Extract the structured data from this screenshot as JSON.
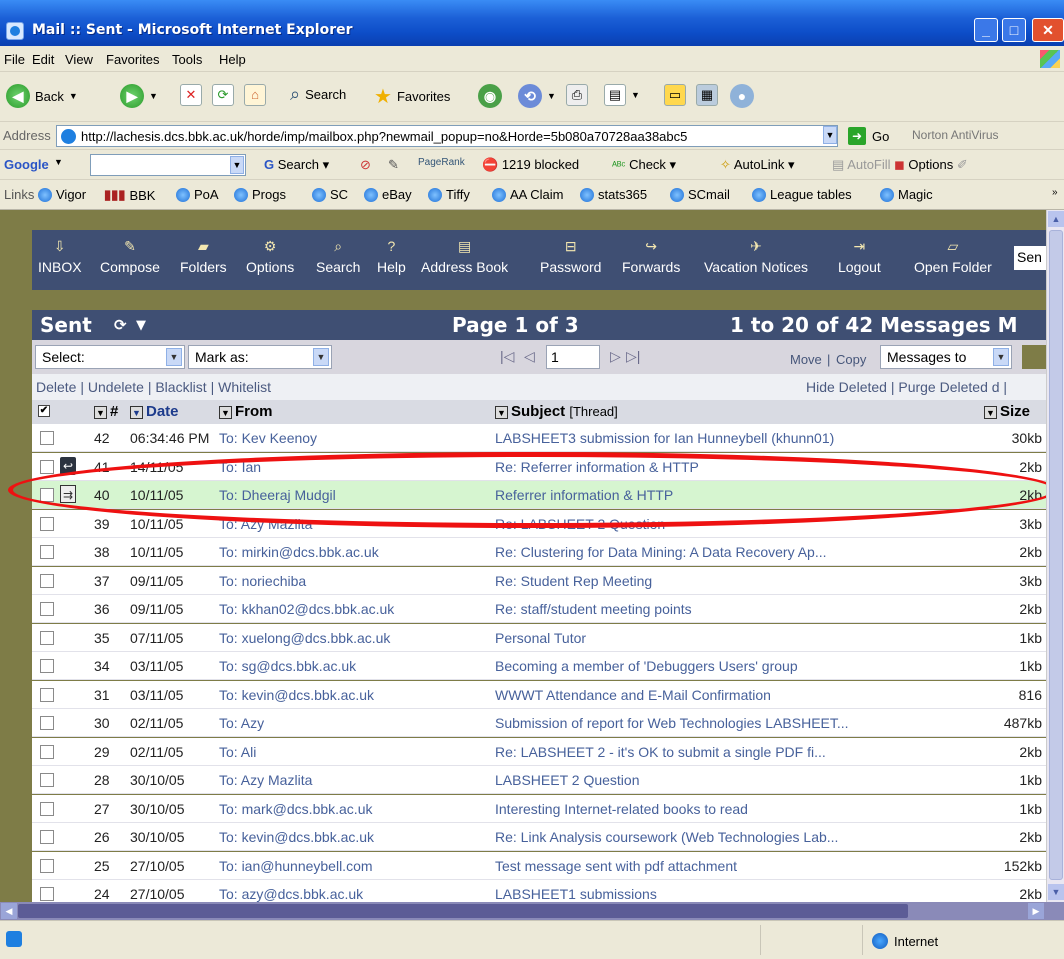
{
  "window": {
    "title": "Mail :: Sent - Microsoft Internet Explorer"
  },
  "menu": [
    "File",
    "Edit",
    "View",
    "Favorites",
    "Tools",
    "Help"
  ],
  "toolbar": {
    "back": "Back",
    "search": "Search",
    "favorites": "Favorites"
  },
  "address": {
    "label": "Address",
    "url": "http://lachesis.dcs.bbk.ac.uk/horde/imp/mailbox.php?newmail_popup=no&Horde=5b080a70728aa38abc5",
    "go": "Go",
    "norton": "Norton AntiVirus"
  },
  "google_bar": {
    "logo": "Google",
    "search": "Search",
    "pagerank": "PageRank",
    "blocked": "1219 blocked",
    "check": "Check",
    "autolink": "AutoLink",
    "autofill": "AutoFill",
    "options": "Options"
  },
  "links_bar": {
    "label": "Links",
    "items": [
      "Vigor",
      "BBK",
      "PoA",
      "Progs",
      "SC",
      "eBay",
      "Tiffy",
      "AA Claim",
      "stats365",
      "SCmail",
      "League tables",
      "Magic"
    ]
  },
  "app_nav": {
    "items": [
      "INBOX",
      "Compose",
      "Folders",
      "Options",
      "Search",
      "Help",
      "Address Book",
      "Password",
      "Forwards",
      "Vacation Notices",
      "Logout",
      "Open Folder"
    ],
    "search_text": "Sen"
  },
  "mailbox": {
    "name": "Sent",
    "page": "Page 1 of 3",
    "count": "1 to 20 of 42 Messages M",
    "select_label": "Select:",
    "mark_as_label": "Mark as:",
    "page_input": "1",
    "move": "Move",
    "copy": "Copy",
    "messages_to": "Messages to",
    "actions_left": "Delete | Undelete | Blacklist | Whitelist",
    "actions_right": "Hide Deleted | Purge Deleted d |"
  },
  "columns": {
    "number": "#",
    "date": "Date",
    "from": "From",
    "subject": "Subject",
    "thread": "[Thread]",
    "size": "Size"
  },
  "messages": [
    {
      "num": "42",
      "date": "06:34:46 PM",
      "from": "To: Kev Keenoy",
      "subject": "LABSHEET3 submission for Ian Hunneybell (khunn01)",
      "size": "30kb",
      "flag": ""
    },
    {
      "num": "41",
      "date": "14/11/05",
      "from": "To: Ian",
      "subject": "Re: Referrer information & HTTP",
      "size": "2kb",
      "flag": "reply"
    },
    {
      "num": "40",
      "date": "10/11/05",
      "from": "To: Dheeraj Mudgil",
      "subject": "Referrer information & HTTP",
      "size": "2kb",
      "flag": "fwd"
    },
    {
      "num": "39",
      "date": "10/11/05",
      "from": "To: Azy Mazlita",
      "subject": "Re: LABSHEET 2 Question",
      "size": "3kb",
      "flag": ""
    },
    {
      "num": "38",
      "date": "10/11/05",
      "from": "To: mirkin@dcs.bbk.ac.uk",
      "subject": "Re: Clustering for Data Mining: A Data Recovery Ap...",
      "size": "2kb",
      "flag": ""
    },
    {
      "num": "37",
      "date": "09/11/05",
      "from": "To: noriechiba",
      "subject": "Re: Student Rep Meeting",
      "size": "3kb",
      "flag": ""
    },
    {
      "num": "36",
      "date": "09/11/05",
      "from": "To: kkhan02@dcs.bbk.ac.uk",
      "subject": "Re: staff/student meeting points",
      "size": "2kb",
      "flag": ""
    },
    {
      "num": "35",
      "date": "07/11/05",
      "from": "To: xuelong@dcs.bbk.ac.uk",
      "subject": "Personal Tutor",
      "size": "1kb",
      "flag": ""
    },
    {
      "num": "34",
      "date": "03/11/05",
      "from": "To: sg@dcs.bbk.ac.uk",
      "subject": "Becoming a member of 'Debuggers Users' group",
      "size": "1kb",
      "flag": ""
    },
    {
      "num": "31",
      "date": "03/11/05",
      "from": "To: kevin@dcs.bbk.ac.uk",
      "subject": "WWWT Attendance and E-Mail Confirmation",
      "size": "816",
      "flag": ""
    },
    {
      "num": "30",
      "date": "02/11/05",
      "from": "To: Azy",
      "subject": "Submission of report for Web Technologies LABSHEET...",
      "size": "487kb",
      "flag": ""
    },
    {
      "num": "29",
      "date": "02/11/05",
      "from": "To: Ali",
      "subject": "Re: LABSHEET 2 - it's OK to submit a single PDF fi...",
      "size": "2kb",
      "flag": ""
    },
    {
      "num": "28",
      "date": "30/10/05",
      "from": "To: Azy Mazlita",
      "subject": "LABSHEET 2 Question",
      "size": "1kb",
      "flag": ""
    },
    {
      "num": "27",
      "date": "30/10/05",
      "from": "To: mark@dcs.bbk.ac.uk",
      "subject": "Interesting Internet-related books to read",
      "size": "1kb",
      "flag": ""
    },
    {
      "num": "26",
      "date": "30/10/05",
      "from": "To: kevin@dcs.bbk.ac.uk",
      "subject": "Re: Link Analysis coursework (Web Technologies Lab...",
      "size": "2kb",
      "flag": ""
    },
    {
      "num": "25",
      "date": "27/10/05",
      "from": "To: ian@hunneybell.com",
      "subject": "Test message sent with pdf attachment",
      "size": "152kb",
      "flag": ""
    },
    {
      "num": "24",
      "date": "27/10/05",
      "from": "To: azy@dcs.bbk.ac.uk",
      "subject": "LABSHEET1 submissions",
      "size": "2kb",
      "flag": ""
    }
  ],
  "highlighted_row": "40",
  "status": {
    "zone": "Internet"
  }
}
